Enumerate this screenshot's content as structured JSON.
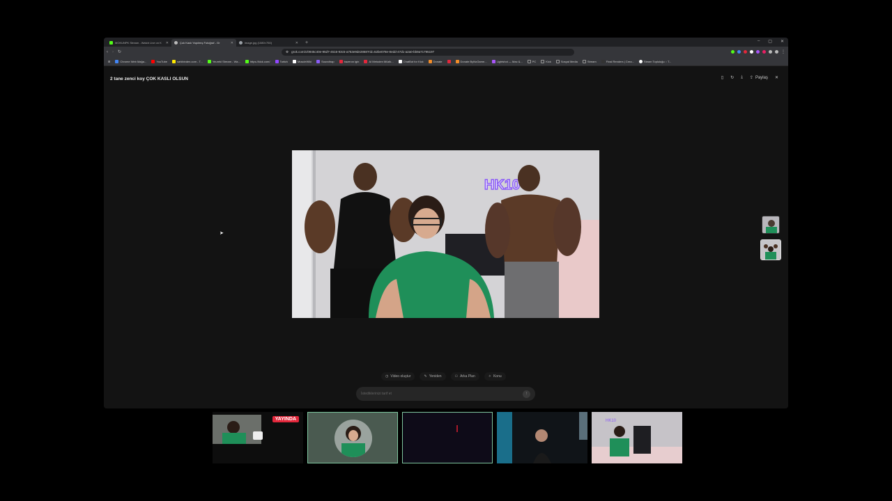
{
  "tabs": [
    {
      "label": "MOKUNPK Stream - Watch Live on K",
      "color": "#53fc18",
      "active": false
    },
    {
      "label": "Çok Kaslı Yapılmış Fotoğraf - Gr",
      "color": "#bbbbbb",
      "active": true
    },
    {
      "label": "image.jpg (1080×750)",
      "color": "#9aa0a6",
      "active": false
    }
  ],
  "new_tab": "+",
  "window_controls": [
    "–",
    "▢",
    "✕"
  ],
  "toolbar": {
    "url": "grok.com/c/0945c40e-95d7-4516-93c5-a753e9de2868?rid=52be078e-8edd-47d1-a2a0-bb9a71795197"
  },
  "bookmarks": [
    {
      "label": "Chrome Web Mağa...",
      "color": "#4285f4"
    },
    {
      "label": "YouTube",
      "color": "#ff0000"
    },
    {
      "label": "sahibinden.com - T...",
      "color": "#ffe800"
    },
    {
      "label": "Yeureki Stream - Wa...",
      "color": "#53fc18"
    },
    {
      "label": "https://kick.com/",
      "color": "#53fc18"
    },
    {
      "label": "Twitch",
      "color": "#9146ff"
    },
    {
      "label": "MuscleWiki",
      "color": "#ffffff"
    },
    {
      "label": "Soundtrap",
      "color": "#8a5cf6"
    },
    {
      "label": "bazeron igin",
      "color": "#e2273b"
    },
    {
      "label": "AI Metoden Müzik...",
      "color": "#e2273b"
    },
    {
      "label": "ChatBot for Kick",
      "color": "#ffffff"
    },
    {
      "label": "Donate",
      "color": "#f28c28"
    },
    {
      "label": "",
      "color": "#e2273b"
    },
    {
      "label": "Donate ByNoGame...",
      "color": "#f28c28"
    },
    {
      "label": "Lightshot — Mac &...",
      "color": "#a855f7"
    },
    {
      "label": "PC",
      "color": "#999999"
    },
    {
      "label": "Kick",
      "color": "#999999"
    },
    {
      "label": "Sosyal Media",
      "color": "#999999"
    },
    {
      "label": "Stream",
      "color": "#999999"
    },
    {
      "label": "Final Renders | Crea...",
      "color": "#333333"
    },
    {
      "label": "Steam Topluluğu :: T...",
      "color": "#ffffff"
    }
  ],
  "content": {
    "title": "2 tane zenci koy ÇOK KASLI OLSUN",
    "share_label": "Paylaş",
    "chips": [
      "Video oluştur",
      "Yeniden",
      "Arka Plan",
      "Konu"
    ],
    "prompt_placeholder": "İstediklerinizi tarif et",
    "image_watermark": "HK10"
  },
  "live_badge": "YAYINDA",
  "colors": {
    "accent_green": "#7fc7a0",
    "live_red": "#e2273b",
    "neon_purple": "#8b5cf6"
  }
}
